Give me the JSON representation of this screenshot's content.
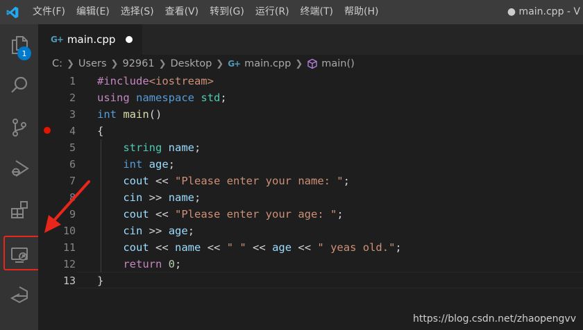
{
  "menu": [
    "文件(F)",
    "编辑(E)",
    "选择(S)",
    "查看(V)",
    "转到(G)",
    "运行(R)",
    "终端(T)",
    "帮助(H)"
  ],
  "window_title": "● main.cpp - V",
  "activity": {
    "explorer_badge": "1"
  },
  "tab": {
    "label": "main.cpp",
    "icon_text": "G+"
  },
  "breadcrumb": {
    "parts": [
      "C:",
      "Users",
      "92961",
      "Desktop",
      "main.cpp",
      "main()"
    ]
  },
  "editor": {
    "line_numbers": [
      "1",
      "2",
      "3",
      "4",
      "5",
      "6",
      "7",
      "8",
      "9",
      "10",
      "11",
      "12",
      "13"
    ],
    "active_line": "13",
    "breakpoint_line": "4"
  },
  "code": {
    "l1": {
      "a": "#include",
      "b": "<iostream>"
    },
    "l2": {
      "a": "using",
      "b": "namespace",
      "c": "std",
      "d": ";"
    },
    "l3": {
      "a": "int",
      "b": "main",
      "c": "()"
    },
    "l4": {
      "a": "{"
    },
    "l5": {
      "a": "string",
      "b": "name",
      "c": ";"
    },
    "l6": {
      "a": "int",
      "b": "age",
      "c": ";"
    },
    "l7": {
      "a": "cout",
      "b": "<<",
      "c": "\"Please enter your name: \"",
      "d": ";"
    },
    "l8": {
      "a": "cin",
      "b": ">>",
      "c": "name",
      "d": ";"
    },
    "l9": {
      "a": "cout",
      "b": "<<",
      "c": "\"Please enter your age: \"",
      "d": ";"
    },
    "l10": {
      "a": "cin",
      "b": ">>",
      "c": "age",
      "d": ";"
    },
    "l11": {
      "a": "cout",
      "b": "<<",
      "c": "name",
      "d": "<<",
      "e": "\" \"",
      "f": "<<",
      "g": "age",
      "h": "<<",
      "i": "\" yeas old.\"",
      "j": ";"
    },
    "l12": {
      "a": "return",
      "b": "0",
      "c": ";"
    },
    "l13": {
      "a": "}"
    }
  },
  "watermark": "https://blog.csdn.net/zhaopengvv",
  "colors": {
    "accent": "#007acc",
    "annotation_red": "#e8261c",
    "breakpoint": "#e51400"
  }
}
